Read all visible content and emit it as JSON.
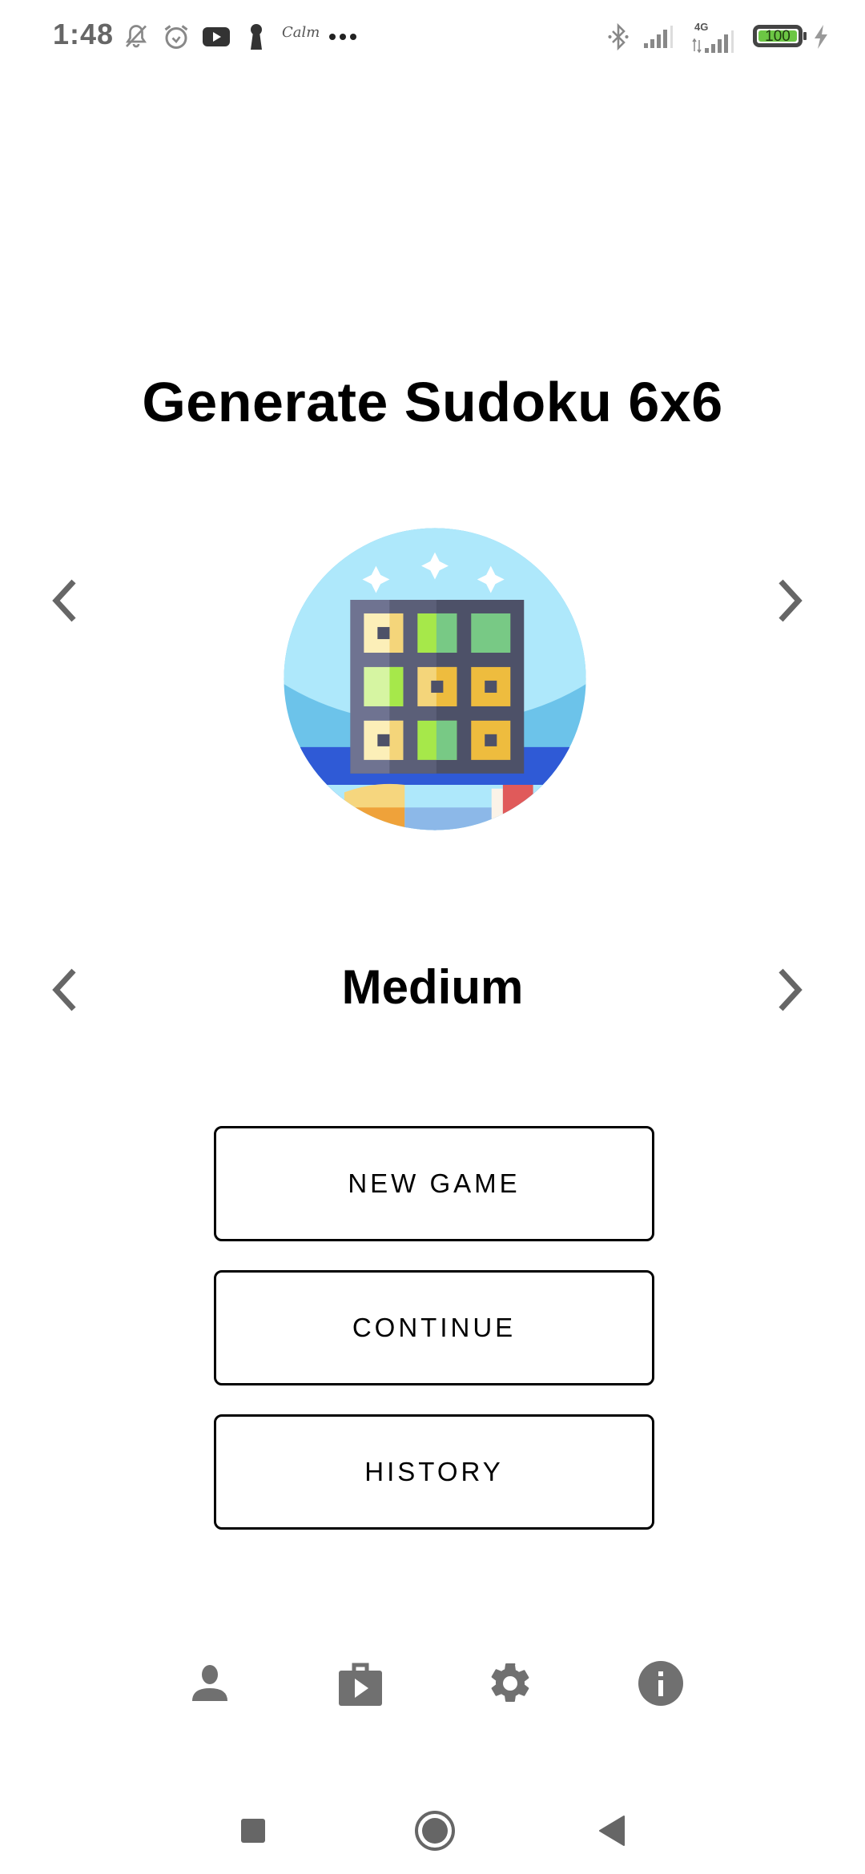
{
  "status_bar": {
    "time": "1:48",
    "notification_icons": [
      "vibrate-muted-icon",
      "alarm-icon",
      "youtube-icon",
      "keyhole-icon",
      "calm-app-icon",
      "more-dots-icon"
    ],
    "calm_label": "Calm",
    "network_type": "4G",
    "battery_level": "100",
    "battery_color": "#6cc644",
    "right_icons": [
      "bluetooth-icon",
      "signal-icon",
      "signal-4g-icon",
      "battery-icon",
      "charging-icon"
    ]
  },
  "main": {
    "title": "Generate Sudoku 6x6",
    "image_alt": "sudoku-grid-illustration",
    "difficulty": "Medium",
    "prev_size_icon": "chevron-left-icon",
    "next_size_icon": "chevron-right-icon",
    "prev_difficulty_icon": "chevron-left-icon",
    "next_difficulty_icon": "chevron-right-icon"
  },
  "buttons": {
    "new_game": "NEW GAME",
    "continue": "CONTINUE",
    "history": "HISTORY"
  },
  "bottom_bar": {
    "items": [
      "profile-icon",
      "play-store-icon",
      "settings-icon",
      "info-icon"
    ],
    "icon_color": "#707070"
  },
  "nav_bar": {
    "items": [
      "recents-icon",
      "home-icon",
      "back-icon"
    ]
  }
}
